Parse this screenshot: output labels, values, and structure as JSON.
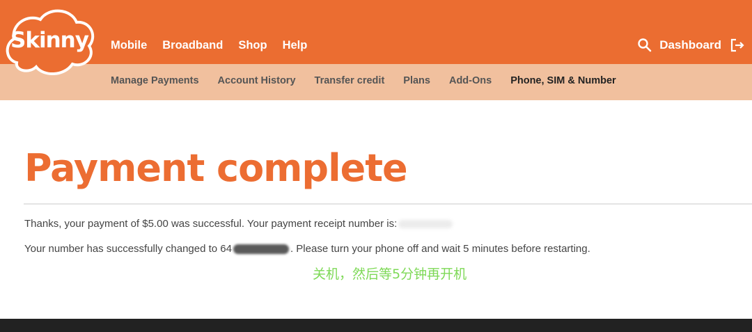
{
  "brand": {
    "name": "Skinny",
    "primary_color": "#eb6d31",
    "subnav_color": "#f1c09e"
  },
  "main_nav": {
    "items": [
      {
        "label": "Mobile"
      },
      {
        "label": "Broadband"
      },
      {
        "label": "Shop"
      },
      {
        "label": "Help"
      }
    ],
    "search_icon": "search-icon",
    "dashboard_label": "Dashboard",
    "logout_icon": "logout-icon"
  },
  "sub_nav": {
    "items": [
      {
        "label": "Manage Payments"
      },
      {
        "label": "Account History"
      },
      {
        "label": "Transfer credit"
      },
      {
        "label": "Plans"
      },
      {
        "label": "Add-Ons"
      },
      {
        "label": "Phone, SIM & Number",
        "active": true
      }
    ]
  },
  "content": {
    "title": "Payment complete",
    "message1": "Thanks, your payment of $5.00 was successful. Your payment receipt number is:",
    "message2_prefix": "Your number has successfully changed to 64",
    "message2_suffix": ". Please turn your phone off and wait 5 minutes before restarting.",
    "annotation": "关机，然后等5分钟再开机"
  }
}
